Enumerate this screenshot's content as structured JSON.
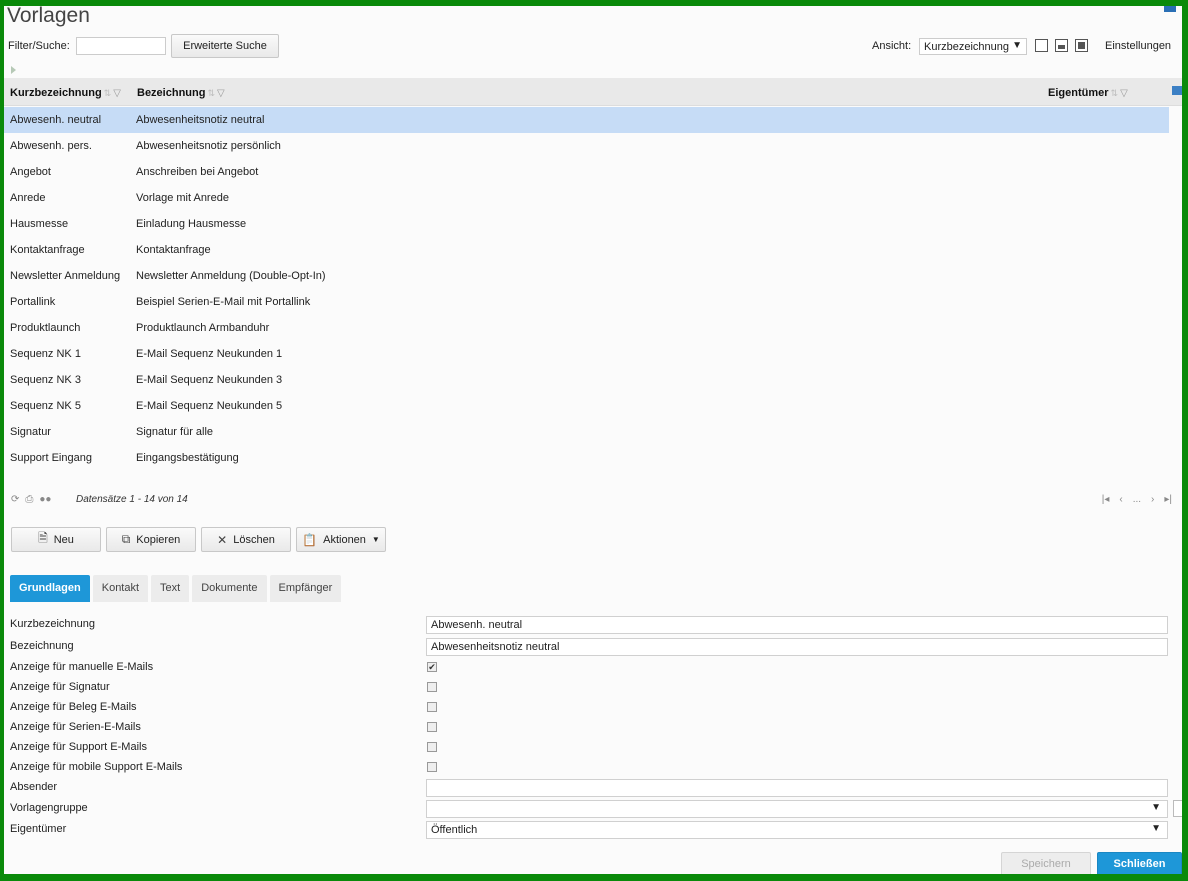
{
  "page": {
    "title": "Vorlagen"
  },
  "filter": {
    "label": "Filter/Suche:",
    "value": "",
    "advanced_search_label": "Erweiterte Suche"
  },
  "view": {
    "label": "Ansicht:",
    "selected": "Kurzbezeichnung",
    "settings_label": "Einstellungen"
  },
  "grid": {
    "headers": [
      "Kurzbezeichnung",
      "Bezeichnung",
      "Eigentümer"
    ],
    "rows": [
      {
        "kurz": "Abwesenh. neutral",
        "bez": "Abwesenheitsnotiz neutral",
        "selected": true
      },
      {
        "kurz": "Abwesenh. pers.",
        "bez": "Abwesenheitsnotiz persönlich"
      },
      {
        "kurz": "Angebot",
        "bez": "Anschreiben bei Angebot"
      },
      {
        "kurz": "Anrede",
        "bez": "Vorlage mit Anrede"
      },
      {
        "kurz": "Hausmesse",
        "bez": "Einladung Hausmesse"
      },
      {
        "kurz": "Kontaktanfrage",
        "bez": "Kontaktanfrage"
      },
      {
        "kurz": "Newsletter Anmeldung",
        "bez": "Newsletter Anmeldung (Double-Opt-In)"
      },
      {
        "kurz": "Portallink",
        "bez": "Beispiel Serien-E-Mail mit Portallink"
      },
      {
        "kurz": "Produktlaunch",
        "bez": "Produktlaunch Armbanduhr"
      },
      {
        "kurz": "Sequenz NK 1",
        "bez": "E-Mail Sequenz Neukunden 1"
      },
      {
        "kurz": "Sequenz NK 3",
        "bez": "E-Mail Sequenz Neukunden 3"
      },
      {
        "kurz": "Sequenz NK 5",
        "bez": "E-Mail Sequenz Neukunden 5"
      },
      {
        "kurz": "Signatur",
        "bez": "Signatur für alle"
      },
      {
        "kurz": "Support Eingang",
        "bez": "Eingangsbestätigung"
      }
    ],
    "record_count": "Datensätze 1 - 14 von 14"
  },
  "toolbar": {
    "new_label": "Neu",
    "copy_label": "Kopieren",
    "delete_label": "Löschen",
    "actions_label": "Aktionen"
  },
  "tabs": [
    "Grundlagen",
    "Kontakt",
    "Text",
    "Dokumente",
    "Empfänger"
  ],
  "form": {
    "kurzbezeichnung": {
      "label": "Kurzbezeichnung",
      "value": "Abwesenh. neutral"
    },
    "bezeichnung": {
      "label": "Bezeichnung",
      "value": "Abwesenheitsnotiz neutral"
    },
    "checks": [
      {
        "label": "Anzeige für manuelle E-Mails",
        "checked": true
      },
      {
        "label": "Anzeige für Signatur",
        "checked": false
      },
      {
        "label": "Anzeige für Beleg E-Mails",
        "checked": false
      },
      {
        "label": "Anzeige für Serien-E-Mails",
        "checked": false
      },
      {
        "label": "Anzeige für Support E-Mails",
        "checked": false
      },
      {
        "label": "Anzeige für mobile Support E-Mails",
        "checked": false
      }
    ],
    "absender": {
      "label": "Absender",
      "value": ""
    },
    "vorlagengruppe": {
      "label": "Vorlagengruppe",
      "value": ""
    },
    "eigentuemer": {
      "label": "Eigentümer",
      "value": "Öffentlich"
    }
  },
  "footer": {
    "save_label": "Speichern",
    "close_label": "Schließen"
  }
}
